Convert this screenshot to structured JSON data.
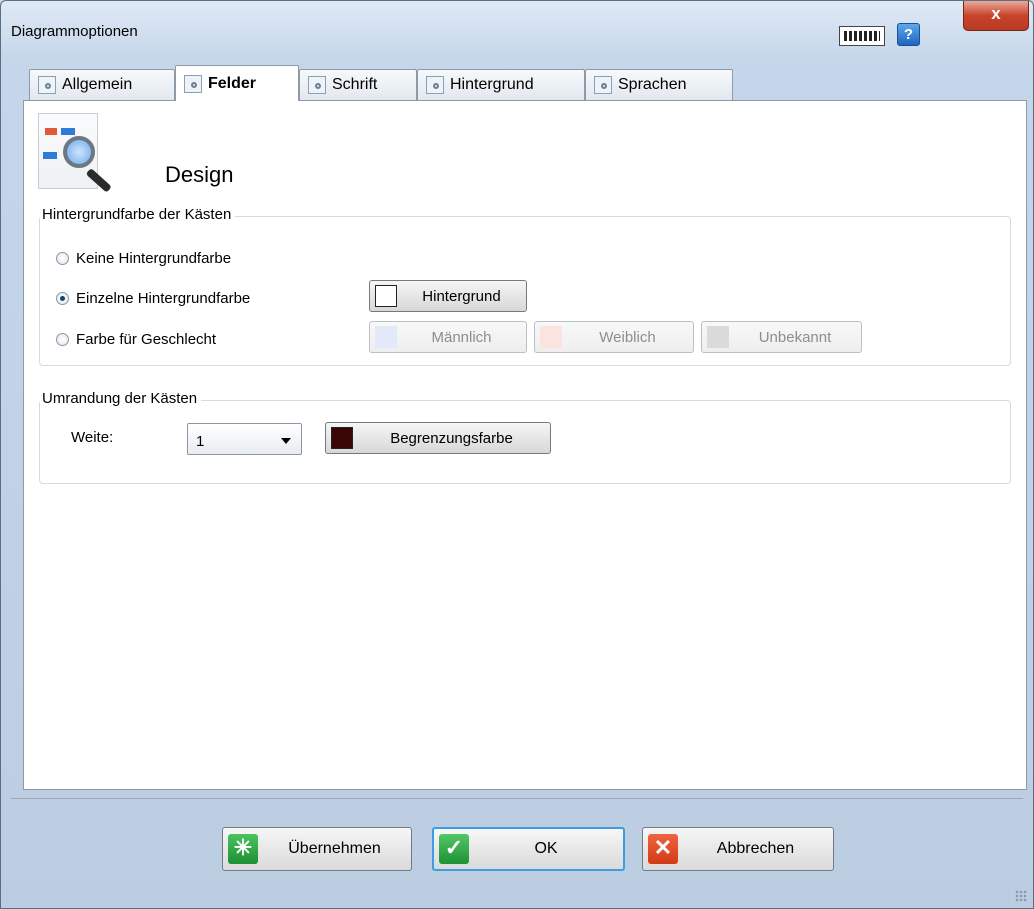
{
  "window": {
    "title": "Diagrammoptionen",
    "help_label": "?",
    "close_label": "x"
  },
  "tabs": [
    {
      "label": "Allgemein",
      "active": false
    },
    {
      "label": "Felder",
      "active": true
    },
    {
      "label": "Schrift",
      "active": false
    },
    {
      "label": "Hintergrund",
      "active": false
    },
    {
      "label": "Sprachen",
      "active": false
    }
  ],
  "section": {
    "title": "Design"
  },
  "box_background": {
    "group_label": "Hintergrundfarbe der Kästen",
    "options": [
      {
        "label": "Keine Hintergrundfarbe",
        "checked": false
      },
      {
        "label": "Einzelne Hintergrundfarbe",
        "checked": true
      },
      {
        "label": "Farbe für Geschlecht",
        "checked": false
      }
    ],
    "background_button": {
      "label": "Hintergrund",
      "color": "#ffffff"
    },
    "male_button": {
      "label": "Männlich",
      "color": "#e3e9f8"
    },
    "female_button": {
      "label": "Weiblich",
      "color": "#fbe3df"
    },
    "unknown_button": {
      "label": "Unbekannt",
      "color": "#dadada"
    }
  },
  "box_border": {
    "group_label": "Umrandung der Kästen",
    "width_label": "Weite:",
    "width_value": "1",
    "border_color_button": {
      "label": "Begrenzungsfarbe",
      "color": "#3a0505"
    }
  },
  "footer": {
    "apply_label": "Übernehmen",
    "ok_label": "OK",
    "cancel_label": "Abbrechen"
  },
  "icons": {
    "apply": "apply-sparkle-icon",
    "ok": "checkmark-icon",
    "cancel": "x-icon",
    "keyboard": "keyboard-icon",
    "help": "help-icon",
    "design": "magnifier-diagram-icon"
  }
}
